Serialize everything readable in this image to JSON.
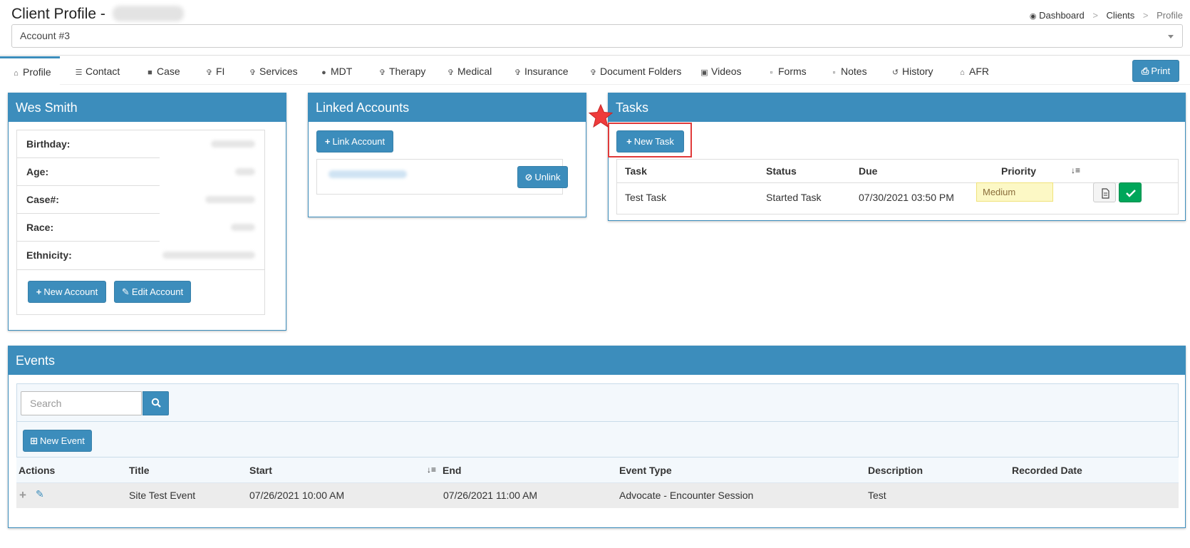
{
  "header": {
    "title": "Client Profile - ",
    "breadcrumb": {
      "dashboard": "Dashboard",
      "clients": "Clients",
      "profile": "Profile",
      "separator": ">"
    },
    "account_select": {
      "value": "Account #3"
    }
  },
  "tabs": [
    {
      "label": "Profile",
      "icon": "home-icon"
    },
    {
      "label": "Contact",
      "icon": "address-card-icon"
    },
    {
      "label": "Case",
      "icon": "briefcase-icon"
    },
    {
      "label": "FI",
      "icon": "child-icon"
    },
    {
      "label": "Services",
      "icon": "child-icon"
    },
    {
      "label": "MDT",
      "icon": "users-icon"
    },
    {
      "label": "Therapy",
      "icon": "child-icon"
    },
    {
      "label": "Medical",
      "icon": "child-icon"
    },
    {
      "label": "Insurance",
      "icon": "child-icon"
    },
    {
      "label": "Document Folders",
      "icon": "child-icon"
    },
    {
      "label": "Videos",
      "icon": "video-file-icon"
    },
    {
      "label": "Forms",
      "icon": "file-icon"
    },
    {
      "label": "Notes",
      "icon": "file-icon"
    },
    {
      "label": "History",
      "icon": "history-icon"
    },
    {
      "label": "AFR",
      "icon": "home-icon"
    }
  ],
  "print_button": {
    "label": "Print",
    "icon": "print-icon"
  },
  "client_box": {
    "title": "Wes Smith",
    "fields": [
      {
        "label": "Birthday:"
      },
      {
        "label": "Age:"
      },
      {
        "label": "Case#:"
      },
      {
        "label": "Race:"
      },
      {
        "label": "Ethnicity:"
      }
    ],
    "new_account_label": "New Account",
    "edit_account_label": "Edit Account"
  },
  "linked_box": {
    "title": "Linked Accounts",
    "link_account_label": "Link Account",
    "unlink_label": "Unlink"
  },
  "tasks_box": {
    "title": "Tasks",
    "new_task_label": "New Task",
    "columns": {
      "task": "Task",
      "status": "Status",
      "due": "Due",
      "priority": "Priority"
    },
    "rows": [
      {
        "task": "Test Task",
        "status": "Started Task",
        "due": "07/30/2021 03:50 PM",
        "priority": "Medium"
      }
    ]
  },
  "events_box": {
    "title": "Events",
    "search_placeholder": "Search",
    "new_event_label": "New Event",
    "columns": {
      "actions": "Actions",
      "title": "Title",
      "start": "Start",
      "end": "End",
      "event_type": "Event Type",
      "description": "Description",
      "recorded_date": "Recorded Date"
    },
    "rows": [
      {
        "title": "Site Test Event",
        "start": "07/26/2021 10:00 AM",
        "end": "07/26/2021 11:00 AM",
        "event_type": "Advocate - Encounter Session",
        "description": "Test",
        "recorded_date": ""
      }
    ]
  },
  "colors": {
    "primary": "#3c8dbc",
    "success": "#00a65a",
    "warning_bg": "#fcf8c5",
    "highlight": "#e03a3a",
    "star": "#ef3b3b"
  }
}
